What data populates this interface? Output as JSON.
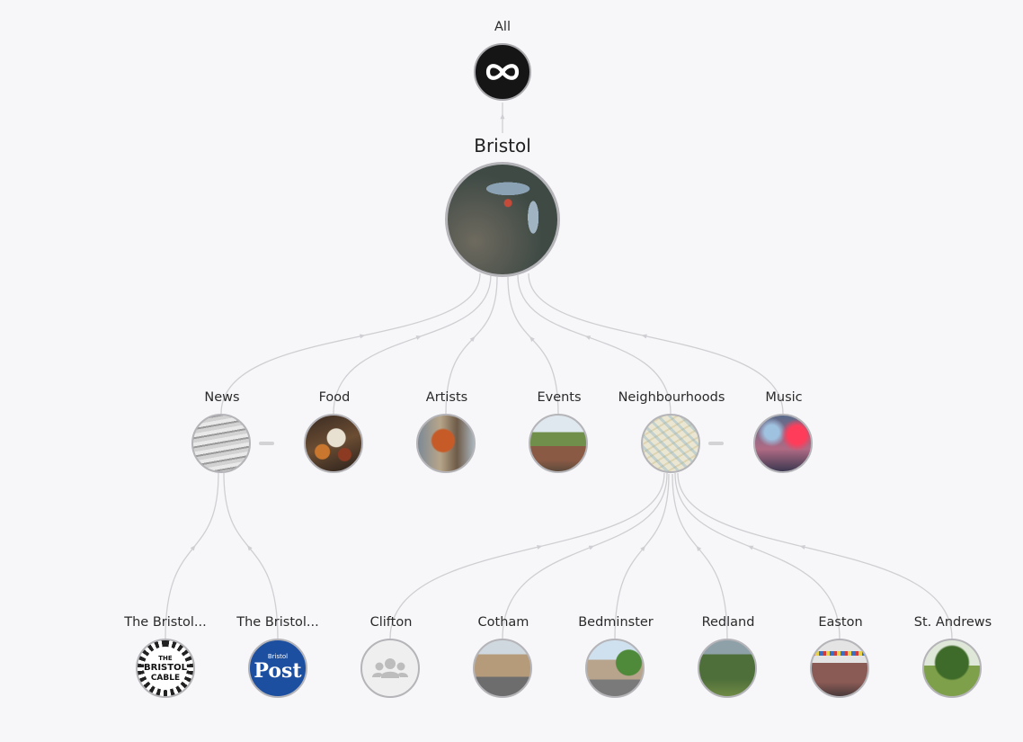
{
  "diagram": {
    "root": {
      "label": "All",
      "icon": "infinity-icon"
    },
    "city": {
      "label": "Bristol",
      "image": "aerial-city-photo"
    },
    "categories": [
      {
        "id": "news",
        "label": "News",
        "image": "newspapers-photo",
        "collapsible": true
      },
      {
        "id": "food",
        "label": "Food",
        "image": "food-plate-photo",
        "collapsible": false
      },
      {
        "id": "artists",
        "label": "Artists",
        "image": "street-art-photo",
        "collapsible": false
      },
      {
        "id": "events",
        "label": "Events",
        "image": "festival-crowd-photo",
        "collapsible": false
      },
      {
        "id": "neighbourhoods",
        "label": "Neighbourhoods",
        "image": "city-map-photo",
        "collapsible": true
      },
      {
        "id": "music",
        "label": "Music",
        "image": "concert-lights-photo",
        "collapsible": false
      }
    ],
    "news_children": [
      {
        "label": "The Bristol...",
        "logo_text_lines": [
          "THE",
          "BRISTOL",
          "CABLE"
        ],
        "image": "bristol-cable-logo"
      },
      {
        "label": "The Bristol...",
        "logo_small": "Bristol",
        "logo_main": "Post",
        "image": "bristol-post-logo"
      }
    ],
    "neighbourhood_children": [
      {
        "label": "Clifton",
        "image": "group-icon"
      },
      {
        "label": "Cotham",
        "image": "terraced-street-photo"
      },
      {
        "label": "Bedminster",
        "image": "high-street-photo"
      },
      {
        "label": "Redland",
        "image": "green-valley-photo"
      },
      {
        "label": "Easton",
        "image": "bunting-street-photo"
      },
      {
        "label": "St. Andrews",
        "image": "park-trees-photo"
      }
    ]
  },
  "colors": {
    "background": "#f7f7f9",
    "edge": "#cfcfd3",
    "node_border": "#b5b5b9",
    "root_fill": "#151515",
    "post_blue": "#1d4fa0"
  }
}
